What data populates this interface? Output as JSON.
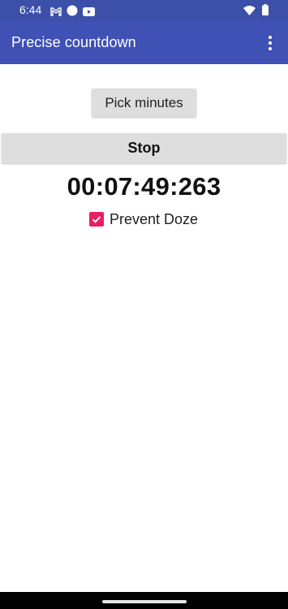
{
  "status_bar": {
    "time": "6:44",
    "left_icons": [
      "gmail-icon",
      "circle-icon",
      "youtube-icon"
    ],
    "right_icons": [
      "wifi-icon",
      "battery-icon"
    ]
  },
  "app_bar": {
    "title": "Precise countdown",
    "menu_icon": "overflow-menu-icon"
  },
  "main": {
    "pick_button_label": "Pick minutes",
    "stop_button_label": "Stop",
    "timer_value": "00:07:49:263",
    "prevent_doze": {
      "label": "Prevent Doze",
      "checked": true
    }
  },
  "colors": {
    "status_bar": "#3c4fa9",
    "app_bar": "#3f51b5",
    "checkbox_accent": "#e91e63",
    "button_bg": "#dedede"
  }
}
